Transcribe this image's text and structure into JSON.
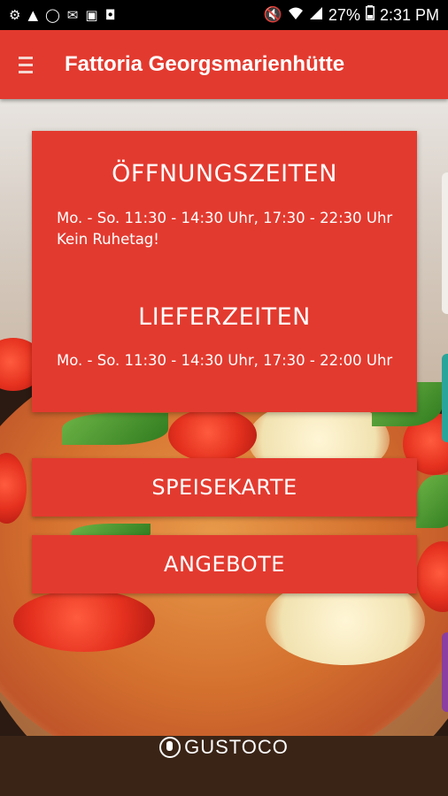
{
  "statusbar": {
    "battery": "27%",
    "time": "2:31 PM",
    "left_icons": [
      "gear-icon",
      "warning-icon",
      "whatsapp-icon",
      "mail-icon",
      "image-icon",
      "package-icon"
    ],
    "right_icons": [
      "mute-icon",
      "wifi-icon",
      "signal-icon",
      "battery-icon"
    ]
  },
  "appbar": {
    "title": "Fattoria Georgsmarienhütte"
  },
  "hours": {
    "opening_title": "ÖFFNUNGSZEITEN",
    "opening_text_1": "Mo. - So. 11:30 - 14:30 Uhr, 17:30 - 22:30 Uhr",
    "opening_text_2": "Kein Ruhetag!",
    "delivery_title": "LIEFERZEITEN",
    "delivery_text": "Mo. - So. 11:30 - 14:30 Uhr, 17:30 - 22:00 Uhr"
  },
  "buttons": {
    "menu": "SPEISEKARTE",
    "offers": "ANGEBOTE"
  },
  "brand": {
    "name": "GUSTOCO"
  },
  "colors": {
    "accent": "#e33a2f",
    "statusbar": "#000000"
  }
}
